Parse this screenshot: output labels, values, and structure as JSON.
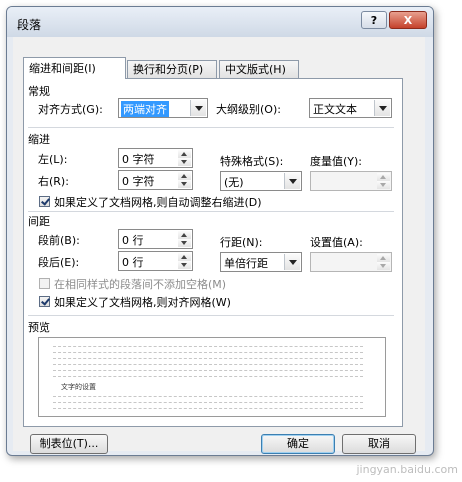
{
  "dialog": {
    "title": "段落",
    "help_glyph": "?",
    "close_glyph": "X"
  },
  "tabs": [
    {
      "label": "缩进和间距(I)",
      "active": true
    },
    {
      "label": "换行和分页(P)",
      "active": false
    },
    {
      "label": "中文版式(H)",
      "active": false
    }
  ],
  "general": {
    "heading": "常规",
    "alignment_label": "对齐方式(G):",
    "alignment_value": "两端对齐",
    "outline_label": "大纲级别(O):",
    "outline_value": "正文文本"
  },
  "indent": {
    "heading": "缩进",
    "left_label": "左(L):",
    "left_value": "0 字符",
    "right_label": "右(R):",
    "right_value": "0 字符",
    "special_label": "特殊格式(S):",
    "special_value": "(无)",
    "measure_label": "度量值(Y):",
    "measure_value": "",
    "auto_adjust_label": "如果定义了文档网格,则自动调整右缩进(D)",
    "auto_adjust_checked": true
  },
  "spacing": {
    "heading": "间距",
    "before_label": "段前(B):",
    "before_value": "0 行",
    "after_label": "段后(E):",
    "after_value": "0 行",
    "line_label": "行距(N):",
    "line_value": "单倍行距",
    "setting_label": "设置值(A):",
    "setting_value": "",
    "no_space_label": "在相同样式的段落间不添加空格(M)",
    "no_space_checked": false,
    "snap_grid_label": "如果定义了文档网格,则对齐网格(W)",
    "snap_grid_checked": true
  },
  "preview": {
    "heading": "预览",
    "sample_text": "文字的设置"
  },
  "buttons": {
    "tabs": "制表位(T)...",
    "ok": "确定",
    "cancel": "取消"
  },
  "watermark": "jingyan.baidu.com"
}
